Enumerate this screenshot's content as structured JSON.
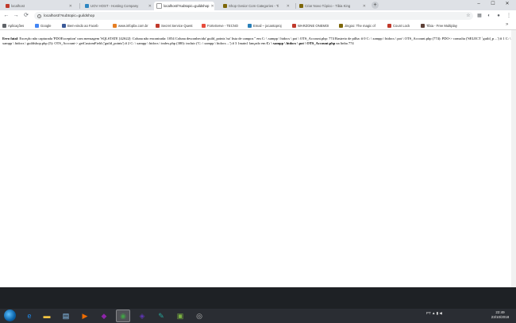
{
  "tabs": [
    {
      "label": "localhost",
      "color": "#c0392b"
    },
    {
      "label": "UOV HOST - Hosting Company",
      "color": "#2e86c1"
    },
    {
      "label": "localhost/?subtopic=guildshop",
      "color": "#ffffff",
      "active": true
    },
    {
      "label": "Shop Gesior Com Categories - Ti",
      "color": "#7d6608"
    },
    {
      "label": "Criar Novo Tópico - Tibia King",
      "color": "#7d6608"
    },
    {
      "label": "Tibia - Free Multiplayer",
      "color": "#5d4037"
    }
  ],
  "new_tab": "+",
  "window_controls": {
    "minimize": "–",
    "maximize": "☐",
    "close": "✕"
  },
  "omnibox": {
    "url": "localhost/?subtopic=guildshop",
    "info": "i"
  },
  "bookmarks": [
    {
      "label": "Aplicações",
      "color": "#5f6368"
    },
    {
      "label": "Google",
      "color": "#4285f4"
    },
    {
      "label": "Bem-vindo ao Faceb",
      "color": "#3b5998"
    },
    {
      "label": "www.infopbx.com.br",
      "color": "#e67e22"
    },
    {
      "label": "Secret Service Quest",
      "color": "#c0392b"
    },
    {
      "label": "ForteServe - TECNO",
      "color": "#e74c3c"
    },
    {
      "label": "Email – jocantoproj",
      "color": "#2980b9"
    },
    {
      "label": "WARZONE ONEMOI",
      "color": "#c0392b"
    },
    {
      "label": "Jingoo: The magic of",
      "color": "#7d6608"
    },
    {
      "label": "Count Lock",
      "color": "#c0392b"
    },
    {
      "label": "Tibia - Free Multiplay",
      "color": "#5d4037"
    }
  ],
  "error": {
    "label": "Erro fatal",
    "line1": ": Exceção não capturada 'PDOException' com mensagem 'SQLSTATE [42S22]: Coluna não encontrada: 1054 Coluna desconhecida' guild_points 'na' lista de campos '' em C: \\ xampp \\ htdocs \\ pot \\ OTS_Account.php: 774 Rastreio de pilha: # 0 C: \\ xampp \\ htdocs \\ pot \\",
    "line2": "OTS_Account.php (774): PDO-> consulta ('SELECT `guild_p ...') # 1 C: \\ xampp \\ htdocs \\ guildshop.php (5): OTS_Account-> getCustomField ('guild_points') # 2 C: \\ xampp \\ htdocs \\ index.php (380): incluir ('C: \\ xampp \\ htdocs ...') # 3 {main} lançado em",
    "path_bold": "C: \\ xampp \\ htdocs \\ pot \\",
    "file_bold": "OTS_Account.php",
    "line_text": "na linha",
    "line_number": "774"
  },
  "taskbar": {
    "apps": [
      {
        "name": "ie-icon",
        "glyph": "e",
        "color": "#1e88e5"
      },
      {
        "name": "folder-icon",
        "glyph": "▬",
        "color": "#f4c542"
      },
      {
        "name": "notepad-icon",
        "glyph": "▤",
        "color": "#90caf9"
      },
      {
        "name": "media-icon",
        "glyph": "▶",
        "color": "#ef6c00"
      },
      {
        "name": "chrome-icon",
        "glyph": "◉",
        "color": "#43a047",
        "active": true
      },
      {
        "name": "game-icon",
        "glyph": "◆",
        "color": "#8e24aa"
      },
      {
        "name": "app-icon",
        "glyph": "◈",
        "color": "#5e35b1"
      },
      {
        "name": "tool-icon",
        "glyph": "✎",
        "color": "#26a69a"
      },
      {
        "name": "android-icon",
        "glyph": "▣",
        "color": "#7cb342"
      },
      {
        "name": "disc-icon",
        "glyph": "◎",
        "color": "#bdbdbd"
      }
    ],
    "language": "PT",
    "time": "22:49",
    "date": "23/10/2018"
  }
}
